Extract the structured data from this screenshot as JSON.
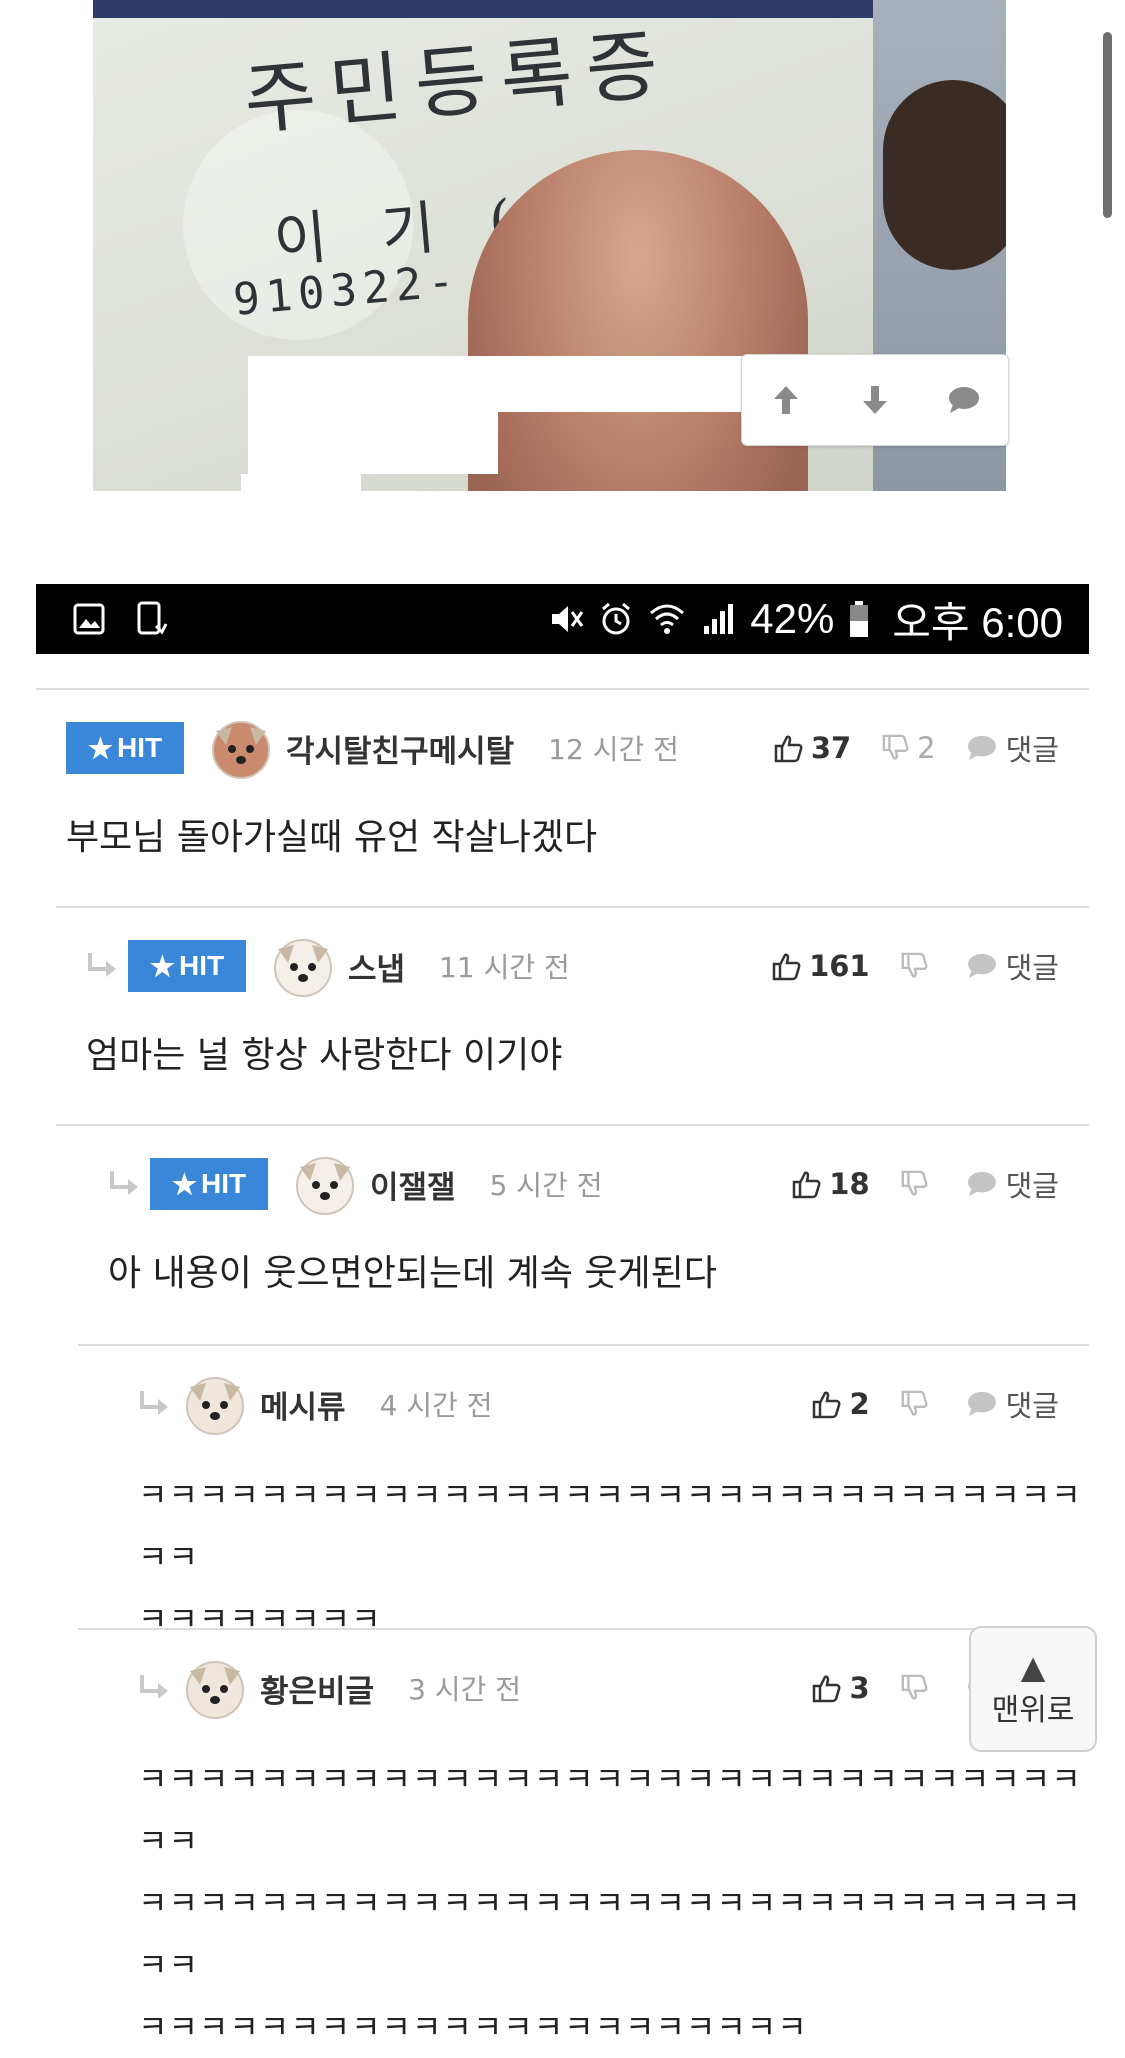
{
  "photo": {
    "card_title": "주민등록증",
    "card_name": "이 기 (李",
    "card_number": "910322-"
  },
  "status_bar": {
    "battery": "42%",
    "time": "오후 6:00",
    "icons": [
      "gallery-icon",
      "screenshot-icon",
      "mute-icon",
      "alarm-icon",
      "wifi-icon",
      "signal-icon",
      "battery-icon"
    ]
  },
  "hit_label": "HIT",
  "reply_label": "댓글",
  "comments": [
    {
      "author": "각시탈친구메시탈",
      "time": "12 시간 전",
      "likes": "37",
      "dislikes": "2",
      "body": "부모님 돌아가실때 유언 작살나겠다",
      "hit": true
    },
    {
      "author": "스냅",
      "time": "11 시간 전",
      "likes": "161",
      "dislikes": "",
      "body": "엄마는 널 항상 사랑한다 이기야",
      "hit": true
    },
    {
      "author": "이잴잴",
      "time": "5 시간 전",
      "likes": "18",
      "dislikes": "",
      "body": "아 내용이 웃으면안되는데 계속 웃게된다",
      "hit": true
    },
    {
      "author": "메시류",
      "time": "4 시간 전",
      "likes": "2",
      "dislikes": "",
      "body": "ㅋㅋㅋㅋㅋㅋㅋㅋㅋㅋㅋㅋㅋㅋㅋㅋㅋㅋㅋㅋㅋㅋㅋㅋㅋㅋㅋㅋㅋㅋㅋㅋㅋ\nㅋㅋㅋㅋㅋㅋㅋㅋ",
      "hit": false
    },
    {
      "author": "황은비글",
      "time": "3 시간 전",
      "likes": "3",
      "dislikes": "",
      "body": "ㅋㅋㅋㅋㅋㅋㅋㅋㅋㅋㅋㅋㅋㅋㅋㅋㅋㅋㅋㅋㅋㅋㅋㅋㅋㅋㅋㅋㅋㅋㅋㅋㅋ\nㅋㅋㅋㅋㅋㅋㅋㅋㅋㅋㅋㅋㅋㅋㅋㅋㅋㅋㅋㅋㅋㅋㅋㅋㅋㅋㅋㅋㅋㅋㅋㅋㅋ\nㅋㅋㅋㅋㅋㅋㅋㅋㅋㅋㅋㅋㅋㅋㅋㅋㅋㅋㅋㅋㅋㅋ",
      "hit": false
    }
  ],
  "scroll_top_button": {
    "arrow": "▲",
    "label": "맨위로"
  },
  "colors": {
    "hit_badge": "#3a86d8",
    "status_bar": "#000000"
  }
}
